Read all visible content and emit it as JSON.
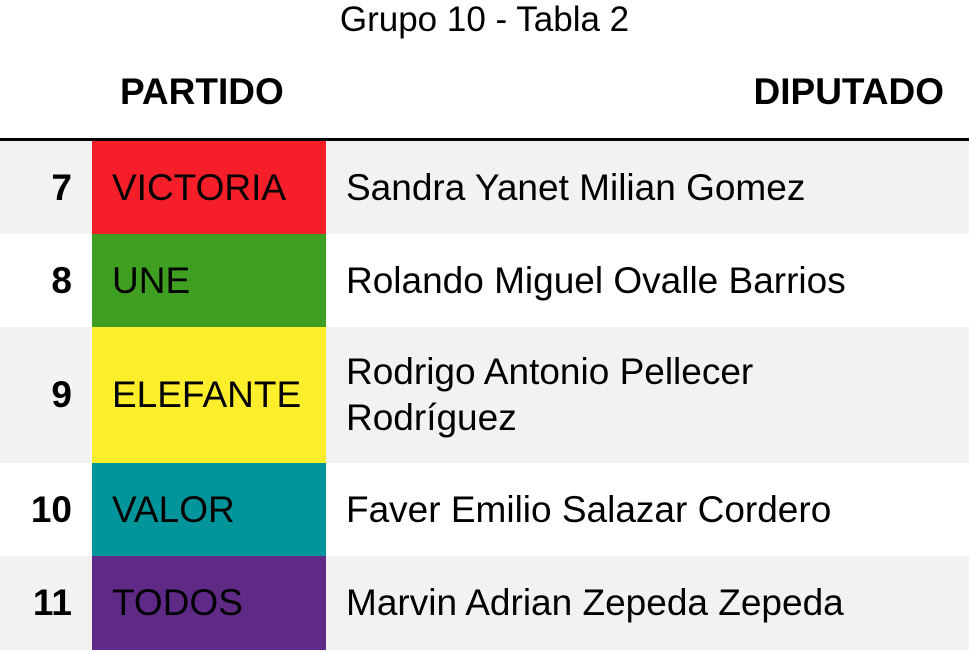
{
  "title": "Grupo 10 - Tabla 2",
  "headers": {
    "party": "PARTIDO",
    "deputy": "DIPUTADO"
  },
  "rows": [
    {
      "number": "7",
      "party": "VICTORIA",
      "party_color": "#f61e28",
      "deputy": "Sandra Yanet Milian Gomez"
    },
    {
      "number": "8",
      "party": "UNE",
      "party_color": "#3f9f21",
      "deputy": "Rolando Miguel Ovalle Barrios"
    },
    {
      "number": "9",
      "party": "ELEFANTE",
      "party_color": "#fdee2c",
      "deputy": "Rodrigo Antonio Pellecer Rodríguez"
    },
    {
      "number": "10",
      "party": "VALOR",
      "party_color": "#00959b",
      "deputy": "Faver Emilio Salazar Cordero"
    },
    {
      "number": "11",
      "party": "TODOS",
      "party_color": "#5e2a86",
      "deputy": "Marvin Adrian Zepeda Zepeda"
    }
  ]
}
